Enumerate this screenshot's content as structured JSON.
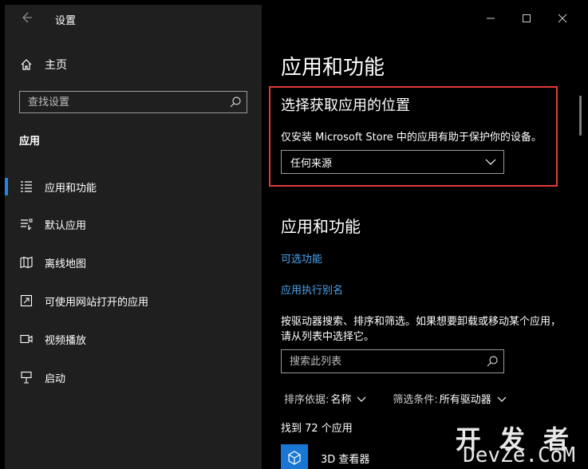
{
  "window": {
    "title": "设置"
  },
  "sidebar": {
    "home_label": "主页",
    "search_placeholder": "查找设置",
    "section_title": "应用",
    "items": [
      {
        "label": "应用和功能",
        "icon": "apps-list-icon",
        "active": true
      },
      {
        "label": "默认应用",
        "icon": "default-apps-icon",
        "active": false
      },
      {
        "label": "离线地图",
        "icon": "offline-maps-icon",
        "active": false
      },
      {
        "label": "可使用网站打开的应用",
        "icon": "apps-for-websites-icon",
        "active": false
      },
      {
        "label": "视频播放",
        "icon": "video-playback-icon",
        "active": false
      },
      {
        "label": "启动",
        "icon": "startup-icon",
        "active": false
      }
    ]
  },
  "main": {
    "page_title": "应用和功能",
    "source_section": {
      "title": "选择获取应用的位置",
      "description": "仅安装 Microsoft Store 中的应用有助于保护你的设备。",
      "dropdown_value": "任何来源"
    },
    "apps_section": {
      "title": "应用和功能",
      "optional_features_link": "可选功能",
      "app_alias_link": "应用执行别名",
      "instructions": "按驱动器搜索、排序和筛选。如果想要卸载或移动某个应用，请从列表中选择它。",
      "search_placeholder": "搜索此列表",
      "sort_label": "排序依据:",
      "sort_value": "名称",
      "filter_label": "筛选条件:",
      "filter_value": "所有驱动器",
      "count_text": "找到 72 个应用",
      "first_app": "3D 查看器"
    }
  },
  "watermark": {
    "line1": "开 发 者",
    "line2": "DevZe.CoM"
  },
  "colors": {
    "accent": "#2b82e0",
    "link": "#4aa5f0",
    "highlight_border": "#e03a3a",
    "sidebar_bg": "#1f1f1f",
    "main_bg": "#000000"
  }
}
